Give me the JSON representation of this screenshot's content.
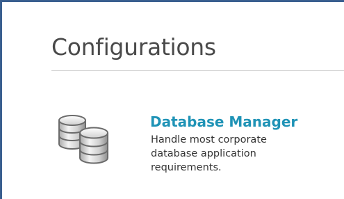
{
  "section": {
    "title": "Configurations"
  },
  "items": [
    {
      "icon": "database-stack-icon",
      "title": "Database Manager",
      "description_lines": [
        "Handle most corporate",
        "database application",
        "requirements."
      ]
    }
  ],
  "colors": {
    "frame_border": "#3a5f8f",
    "title_text": "#4a4a4a",
    "link_text": "#1f93b6",
    "divider": "#d4d4d4"
  }
}
